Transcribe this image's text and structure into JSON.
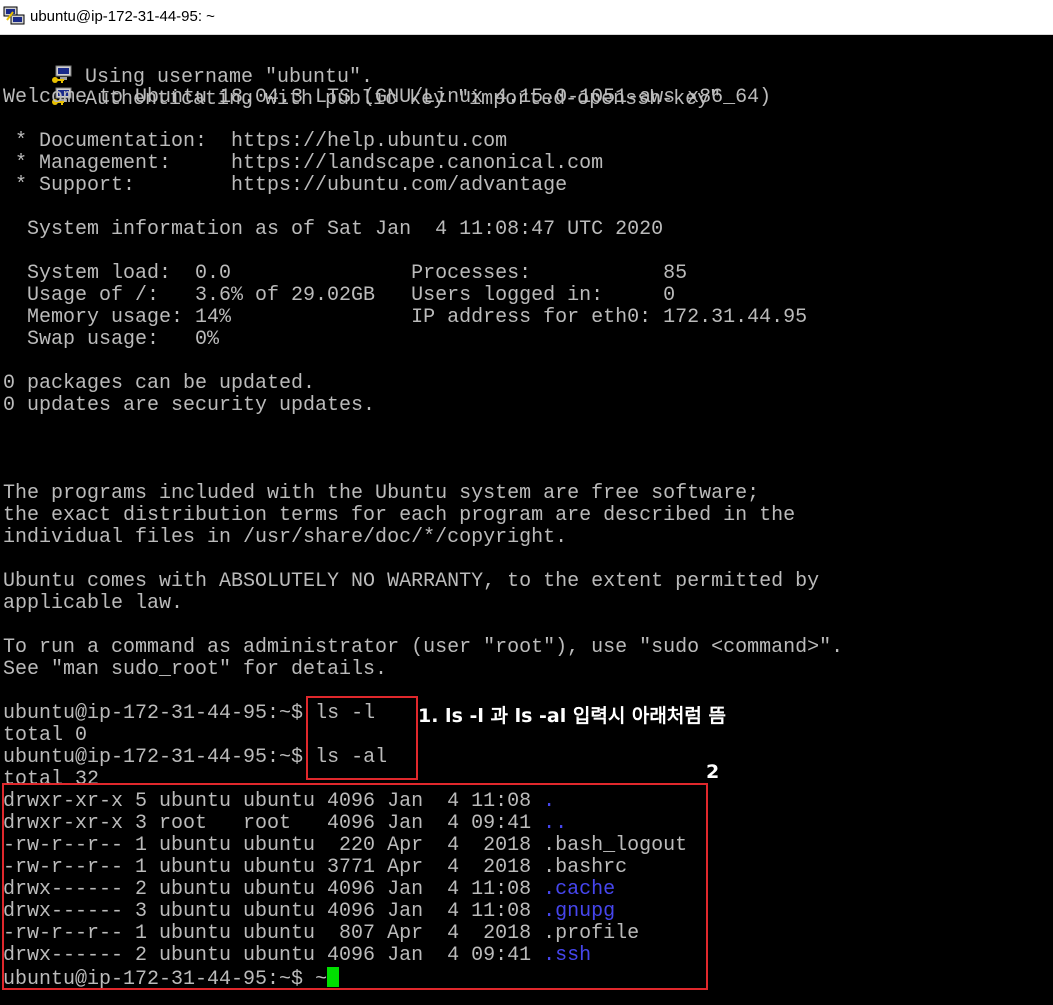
{
  "window": {
    "title": "ubuntu@ip-172-31-44-95: ~",
    "icon": "putty-computer-icon"
  },
  "colors": {
    "text": "#bbbbbb",
    "directory": "#4646ee",
    "cursor": "#00e000",
    "annotation_box": "#e0282c",
    "annotation_text": "#ffffff"
  },
  "terminal": {
    "login_lines": [
      {
        "icon": "key-computer-icon",
        "text": "Using username \"ubuntu\"."
      },
      {
        "icon": "key-computer-icon",
        "text": "Authenticating with public key \"imported-openssh-key\""
      }
    ],
    "welcome": "Welcome to Ubuntu 18.04.3 LTS (GNU/Linux 4.15.0-1051-aws x86_64)",
    "docs": [
      " * Documentation:  https://help.ubuntu.com",
      " * Management:     https://landscape.canonical.com",
      " * Support:        https://ubuntu.com/advantage"
    ],
    "sysinfo_header": "  System information as of Sat Jan  4 11:08:47 UTC 2020",
    "sysinfo": [
      "  System load:  0.0               Processes:           85",
      "  Usage of /:   3.6% of 29.02GB   Users logged in:     0",
      "  Memory usage: 14%               IP address for eth0: 172.31.44.95",
      "  Swap usage:   0%"
    ],
    "updates": [
      "0 packages can be updated.",
      "0 updates are security updates."
    ],
    "license": [
      "The programs included with the Ubuntu system are free software;",
      "the exact distribution terms for each program are described in the",
      "individual files in /usr/share/doc/*/copyright.",
      "",
      "Ubuntu comes with ABSOLUTELY NO WARRANTY, to the extent permitted by",
      "applicable law.",
      "",
      "To run a command as administrator (user \"root\"), use \"sudo <command>\".",
      "See \"man sudo_root\" for details."
    ],
    "prompt": "ubuntu@ip-172-31-44-95:~$ ",
    "cmd1": "ls -l",
    "cmd1_output": "total 0",
    "cmd2": "ls -al",
    "cmd2_output": "total 32",
    "listing": [
      {
        "meta": "drwxr-xr-x 5 ubuntu ubuntu 4096 Jan  4 11:08 ",
        "name": ".",
        "dir": true
      },
      {
        "meta": "drwxr-xr-x 3 root   root   4096 Jan  4 09:41 ",
        "name": "..",
        "dir": true
      },
      {
        "meta": "-rw-r--r-- 1 ubuntu ubuntu  220 Apr  4  2018 ",
        "name": ".bash_logout",
        "dir": false
      },
      {
        "meta": "-rw-r--r-- 1 ubuntu ubuntu 3771 Apr  4  2018 ",
        "name": ".bashrc",
        "dir": false
      },
      {
        "meta": "drwx------ 2 ubuntu ubuntu 4096 Jan  4 11:08 ",
        "name": ".cache",
        "dir": true
      },
      {
        "meta": "drwx------ 3 ubuntu ubuntu 4096 Jan  4 11:08 ",
        "name": ".gnupg",
        "dir": true
      },
      {
        "meta": "-rw-r--r-- 1 ubuntu ubuntu  807 Apr  4  2018 ",
        "name": ".profile",
        "dir": false
      },
      {
        "meta": "drwx------ 2 ubuntu ubuntu 4096 Jan  4 09:41 ",
        "name": ".ssh",
        "dir": true
      }
    ],
    "final_prompt": "ubuntu@ip-172-31-44-95:~$ ",
    "final_input": "~"
  },
  "annotations": {
    "label1": "1. ls -l 과 ls -al 입력시 아래처럼 뜸",
    "label2": "2"
  }
}
